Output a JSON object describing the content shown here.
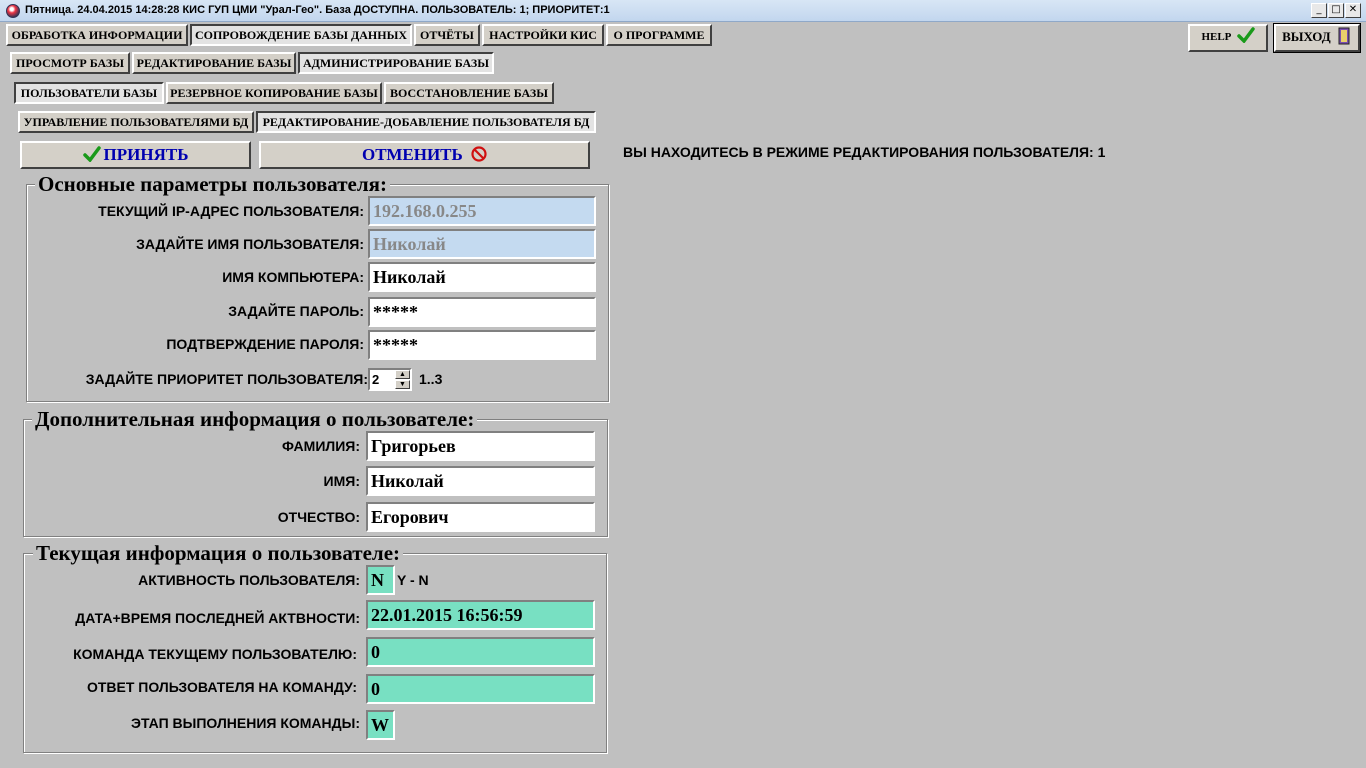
{
  "window": {
    "title": "Пятница. 24.04.2015 14:28:28 КИС ГУП ЦМИ \"Урал-Гео\". База ДОСТУПНА. ПОЛЬЗОВАТЕЛЬ: 1; ПРИОРИТЕТ:1",
    "minimize_glyph": "_",
    "maximize_glyph": "□",
    "close_glyph": "✕"
  },
  "main_tabs": [
    {
      "label": "ОБРАБОТКА ИНФОРМАЦИИ",
      "active": false
    },
    {
      "label": "СОПРОВОЖДЕНИЕ БАЗЫ ДАННЫХ",
      "active": true
    },
    {
      "label": "ОТЧЁТЫ",
      "active": false
    },
    {
      "label": "НАСТРОЙКИ КИС",
      "active": false
    },
    {
      "label": "О ПРОГРАММЕ",
      "active": false
    }
  ],
  "top_right": {
    "help_label": "HELP",
    "exit_label": "ВЫХОД"
  },
  "sub_tabs": [
    {
      "label": "ПРОСМОТР БАЗЫ",
      "active": false
    },
    {
      "label": "РЕДАКТИРОВАНИЕ БАЗЫ",
      "active": false
    },
    {
      "label": "АДМИНИСТРИРОВАНИЕ БАЗЫ",
      "active": true
    }
  ],
  "admin_tabs": [
    {
      "label": "ПОЛЬЗОВАТЕЛИ БАЗЫ",
      "active": true
    },
    {
      "label": "РЕЗЕРВНОЕ КОПИРОВАНИЕ БАЗЫ",
      "active": false
    },
    {
      "label": "ВОССТАНОВЛЕНИЕ БАЗЫ",
      "active": false
    }
  ],
  "user_tabs": [
    {
      "label": "УПРАВЛЕНИЕ ПОЛЬЗОВАТЕЛЯМИ БД",
      "active": false
    },
    {
      "label": "РЕДАКТИРОВАНИЕ-ДОБАВЛЕНИЕ  ПОЛЬЗОВАТЕЛЯ БД",
      "active": true
    }
  ],
  "actions": {
    "accept_label": "ПРИНЯТЬ",
    "cancel_label": "ОТМЕНИТЬ"
  },
  "mode_text": "ВЫ НАХОДИТЕСЬ В РЕЖИМЕ РЕДАКТИРОВАНИЯ ПОЛЬЗОВАТЕЛЯ: 1",
  "basic": {
    "title": "Основные параметры пользователя:",
    "fields": [
      {
        "label": "ТЕКУЩИЙ IP-АДРЕС ПОЛЬЗОВАТЕЛЯ:",
        "value": "192.168.0.255",
        "disabled": true
      },
      {
        "label": "ЗАДАЙТЕ ИМЯ ПОЛЬЗОВАТЕЛЯ:",
        "value": "Николай",
        "disabled": true
      },
      {
        "label": "ИМЯ КОМПЬЮТЕРА:",
        "value": "Николай",
        "disabled": false
      },
      {
        "label": "ЗАДАЙТЕ ПАРОЛЬ:",
        "value": "*****",
        "disabled": false
      },
      {
        "label": "ПОДТВЕРЖДЕНИЕ ПАРОЛЯ:",
        "value": "*****",
        "disabled": false
      }
    ],
    "priority_label": "ЗАДАЙТЕ ПРИОРИТЕТ ПОЛЬЗОВАТЕЛЯ:",
    "priority_value": "2",
    "priority_range": "1..3"
  },
  "extra": {
    "title": "Дополнительная информация о пользователе:",
    "fields": [
      {
        "label": "ФАМИЛИЯ:",
        "value": "Григорьев"
      },
      {
        "label": "ИМЯ:",
        "value": "Николай"
      },
      {
        "label": "ОТЧЕСТВО:",
        "value": "Егорович"
      }
    ]
  },
  "current": {
    "title": "Текущая информация о пользователе:",
    "activity_label": "АКТИВНОСТЬ ПОЛЬЗОВАТЕЛЯ:",
    "activity_value": "N",
    "activity_hint": "Y - N",
    "last_activity_label": "ДАТА+ВРЕМЯ ПОСЛЕДНЕЙ АКТВНОСТИ:",
    "last_activity_value": "22.01.2015 16:56:59",
    "command_label": "КОМАНДА ТЕКУЩЕМУ ПОЛЬЗОВАТЕЛЮ:",
    "command_value": "0",
    "response_label": "ОТВЕТ ПОЛЬЗОВАТЕЛЯ НА КОМАНДУ:",
    "response_value": "0",
    "stage_label": "ЭТАП ВЫПОЛНЕНИЯ КОМАНДЫ:",
    "stage_value": "W"
  },
  "colors": {
    "accent_text": "#0000b0",
    "readonly_field": "#c4daf0",
    "status_field": "#78e0c2"
  }
}
